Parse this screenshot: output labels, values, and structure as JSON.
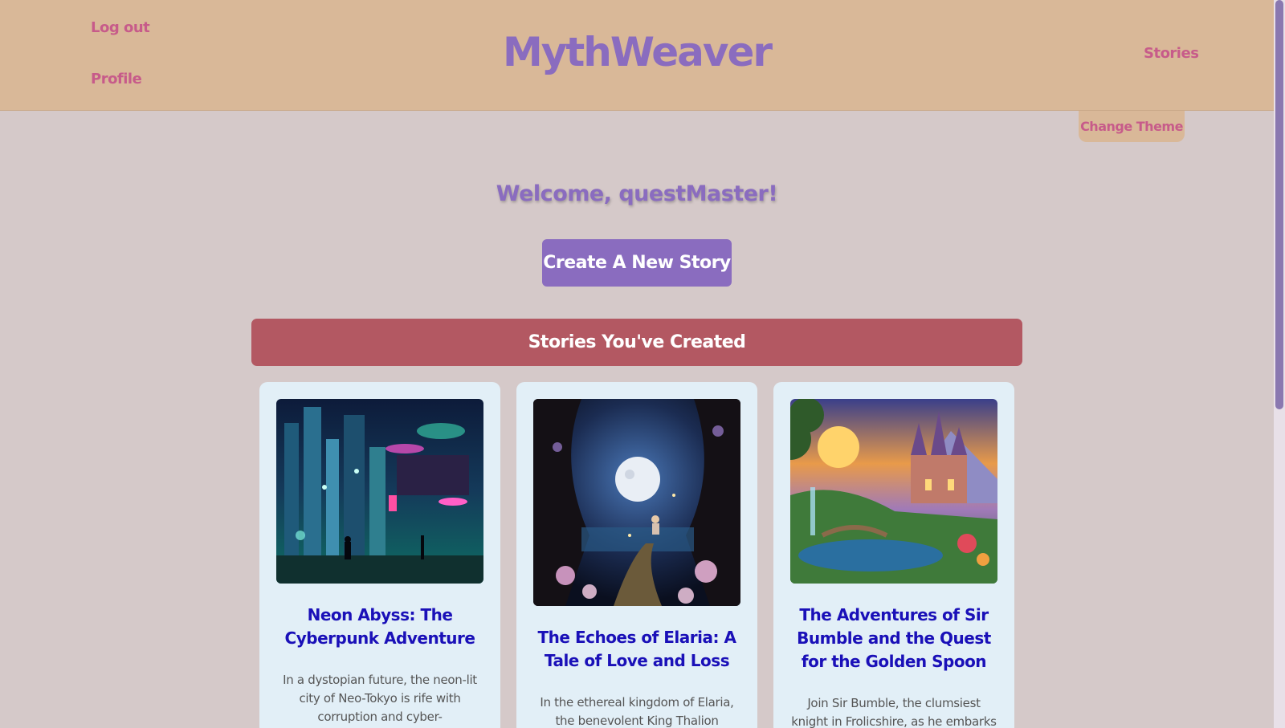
{
  "header": {
    "logo": "MythWeaver",
    "nav_left": [
      "Log out",
      "Profile"
    ],
    "nav_right": "Stories",
    "theme_button": "Change Theme"
  },
  "welcome": "Welcome, questMaster!",
  "create_button": "Create A New Story",
  "section_title": "Stories You've Created",
  "stories": [
    {
      "title": "Neon Abyss: The Cyberpunk Adventure",
      "desc": "In a dystopian future, the neon-lit city of Neo-Tokyo is rife with corruption and cyber-enhancements. You are a"
    },
    {
      "title": "The Echoes of Elaria: A Tale of Love and Loss",
      "desc": "In the ethereal kingdom of Elaria, the benevolent King Thalion embarks on a"
    },
    {
      "title": "The Adventures of Sir Bumble and the Quest for the Golden Spoon",
      "desc": "Join Sir Bumble, the clumsiest knight in Frolicshire, as he embarks on a hilarious"
    }
  ],
  "colors": {
    "header_bg": "#d9b898",
    "page_bg": "#d5c9c9",
    "accent_purple": "#8a6cbf",
    "link_pink": "#c75b8a",
    "section_red": "#b35862",
    "card_bg": "#e2eff7",
    "card_title": "#1a10b8"
  }
}
